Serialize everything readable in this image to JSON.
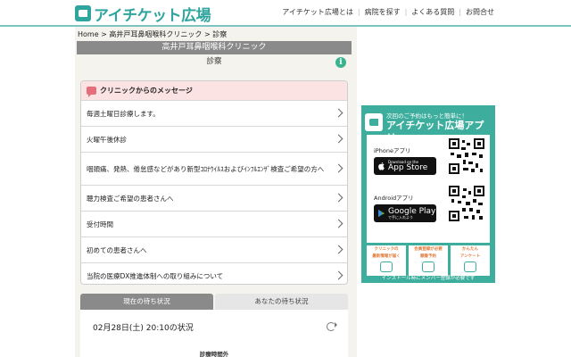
{
  "header": {
    "logo_text": "アイチケット広場",
    "nav": [
      "アイチケット広場とは",
      "病院を探す",
      "よくある質問",
      "お問合せ"
    ]
  },
  "breadcrumb": {
    "home": "Home",
    "clinic": "高井戸耳鼻咽喉科クリニック",
    "current": "診察"
  },
  "clinic_name": "高井戸耳鼻咽喉科クリニック",
  "section_title": "診察",
  "messages": {
    "header": "クリニックからのメッセージ",
    "items": [
      "毎週土曜日診療します。",
      "火曜午後休診",
      "咽頭痛、発熱、倦怠感などがあり新型ｺﾛﾅｳｲﾙｽおよびｲﾝﾌﾙｴﾝｻﾞ検査ご希望の方へ",
      "聴力検査ご希望の患者さんへ",
      "受付時間",
      "初めての患者さんへ",
      "当院の医療DX推進体制への取り組みについて"
    ]
  },
  "tabs": [
    "現在の待ち状況",
    "あなたの待ち状況"
  ],
  "status": {
    "time_text": "02月28日(土) 20:10の状況",
    "sub_text": "診療時間外"
  },
  "ad": {
    "close": "i",
    "subtitle": "次回のご予約はもっと簡単に！",
    "title": "アイチケット広場アプリ",
    "iphone_label": "iPhoneアプリ",
    "appstore_small": "Download on the",
    "appstore_big": "App Store",
    "android_label": "Androidアプリ",
    "googleplay_small": "で手に入れよう",
    "googleplay_big": "Google Play",
    "features": [
      [
        "クリニックの",
        "最新情報が届く"
      ],
      [
        "会員登録が必要",
        "順番予約"
      ],
      [
        "かんたん",
        "アンケート"
      ]
    ],
    "footer": "インストール時にメンバー登録が必要です",
    "colors": {
      "brand": "#3dae9d",
      "accent": "#e07a3a"
    }
  }
}
